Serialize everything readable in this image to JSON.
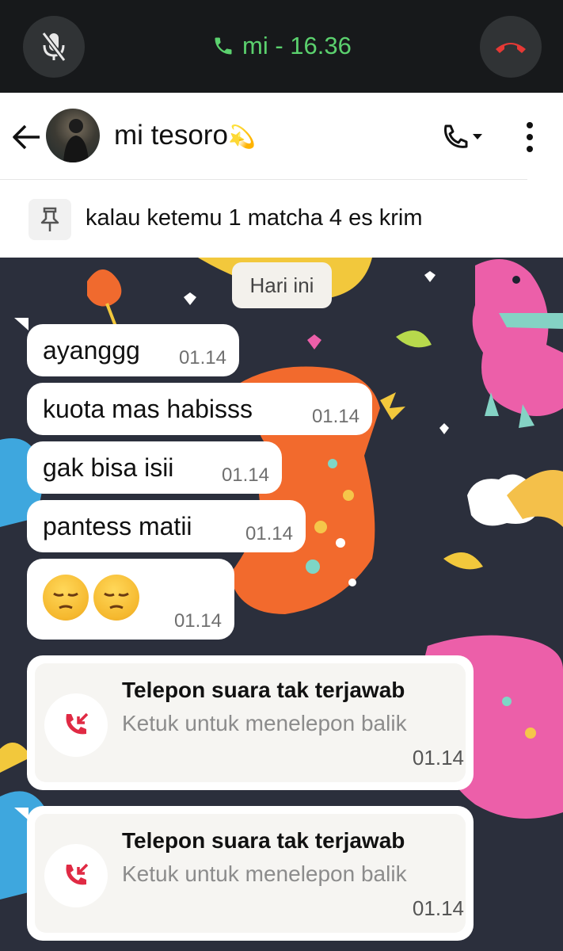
{
  "call_banner": {
    "status": "mi - 16.36",
    "mute_icon": "mic-off-icon",
    "end_icon": "call-end-icon"
  },
  "header": {
    "back_icon": "arrow-left-icon",
    "contact_name": "mi tesoro",
    "name_emoji": "💫",
    "call_icon": "phone-dropdown-icon",
    "more_icon": "more-vertical-icon"
  },
  "pinned": {
    "icon": "pin-icon",
    "text": "kalau ketemu 1 matcha 4 es krim"
  },
  "chat": {
    "date_label": "Hari ini",
    "messages": [
      {
        "text": "ayanggg",
        "time": "01.14"
      },
      {
        "text": "kuota mas habisss",
        "time": "01.14"
      },
      {
        "text": "gak bisa isii",
        "time": "01.14"
      },
      {
        "text": "pantess matii",
        "time": "01.14"
      },
      {
        "text": "😔😔",
        "time": "01.14"
      }
    ],
    "missed_calls": [
      {
        "title": "Telepon suara tak terjawab",
        "subtitle": "Ketuk untuk menelepon balik",
        "time": "01.14"
      },
      {
        "title": "Telepon suara tak terjawab",
        "subtitle": "Ketuk untuk menelepon balik",
        "time": "01.14"
      }
    ]
  },
  "colors": {
    "call_green": "#5bd16e",
    "end_red": "#e53935",
    "missed_red": "#e02a44",
    "wallpaper_bg": "#2b2f3c"
  }
}
